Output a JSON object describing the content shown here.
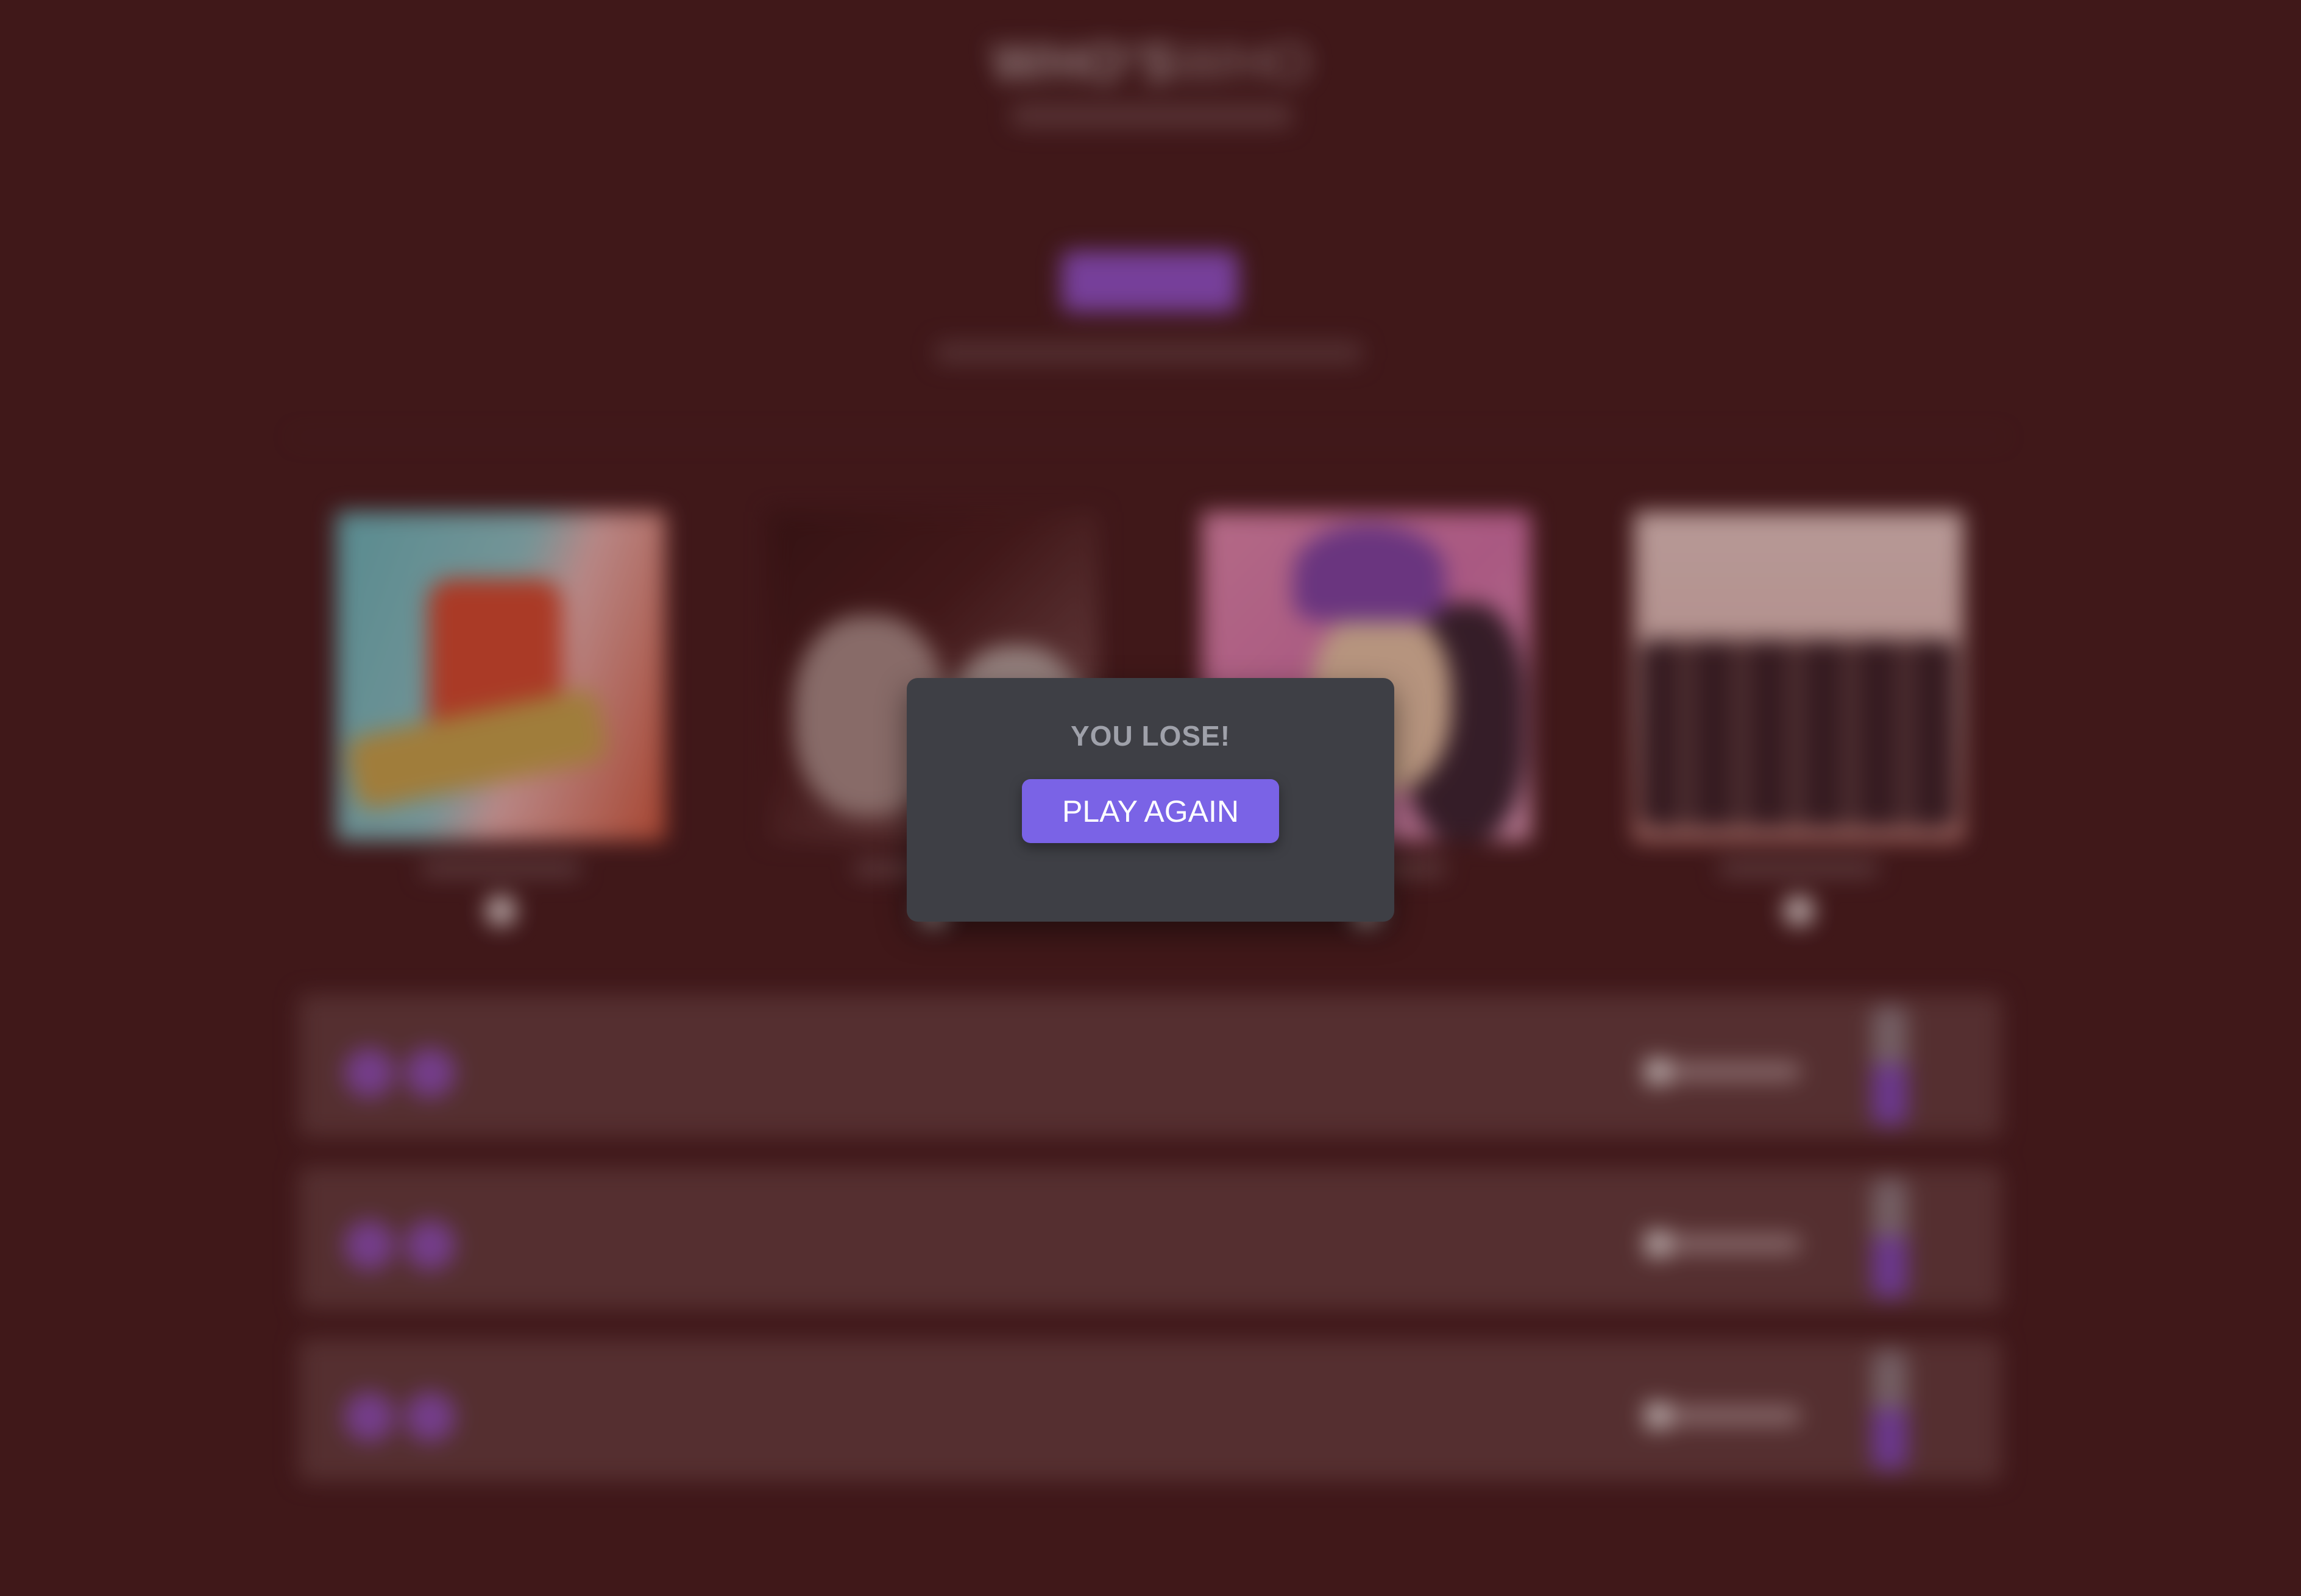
{
  "app": {
    "logo_part1": "WHO'S",
    "logo_part2": "WHO"
  },
  "modal": {
    "title": "YOU LOSE!",
    "button_label": "PLAY AGAIN"
  },
  "board": {
    "artists": [
      {
        "id": "artist-1"
      },
      {
        "id": "artist-2"
      },
      {
        "id": "artist-3"
      },
      {
        "id": "artist-4"
      }
    ],
    "song_rows": 3
  },
  "colors": {
    "background": "#481c1d",
    "modal_bg": "#3e3f45",
    "accent": "#7a63e6",
    "row_bg": "#643b3b",
    "purple": "#8e4eb4"
  }
}
